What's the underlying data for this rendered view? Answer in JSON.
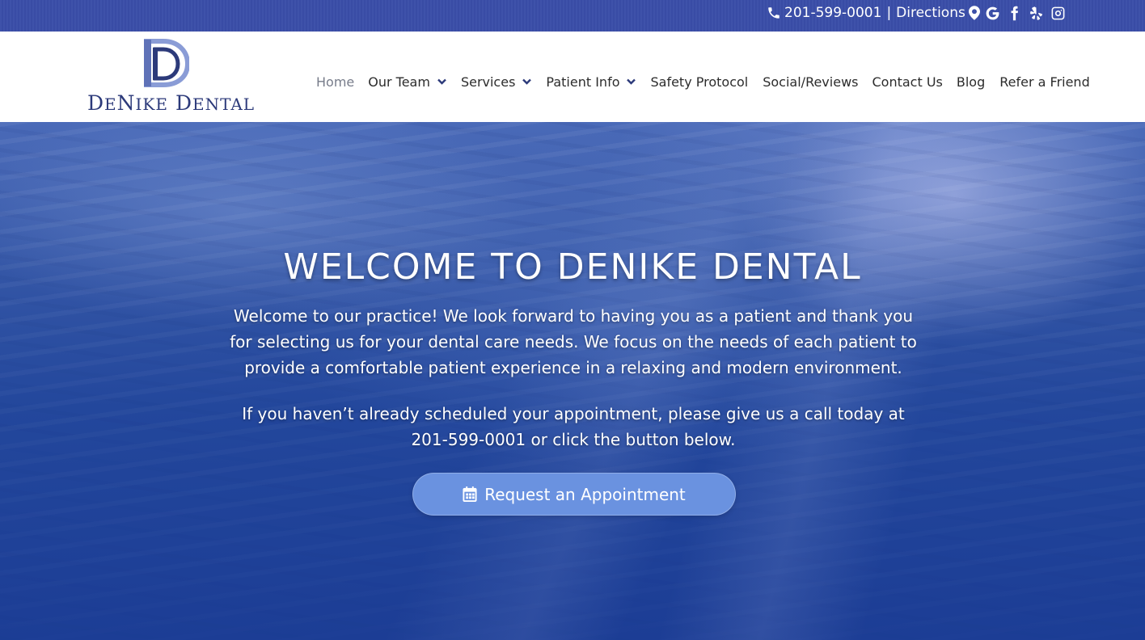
{
  "topbar": {
    "phone": "201-599-0001",
    "separator": "|",
    "directions": "Directions",
    "icons": [
      "phone-icon",
      "map-pin-icon",
      "google-icon",
      "facebook-icon",
      "yelp-icon",
      "instagram-icon"
    ]
  },
  "logo": {
    "text_de": "D",
    "text_e": "E",
    "text_n": "N",
    "text_ike": "IKE",
    "text_d2": "D",
    "text_ental": "ENTAL"
  },
  "nav": {
    "items": [
      {
        "label": "Home",
        "active": true
      },
      {
        "label": "Our Team",
        "dropdown": true
      },
      {
        "label": "Services",
        "dropdown": true
      },
      {
        "label": "Patient Info",
        "dropdown": true
      },
      {
        "label": "Safety Protocol"
      },
      {
        "label": "Social/Reviews"
      },
      {
        "label": "Contact Us"
      },
      {
        "label": "Blog"
      },
      {
        "label": "Refer a Friend"
      }
    ]
  },
  "hero": {
    "title": "WELCOME TO DENIKE DENTAL",
    "paragraph1": "Welcome to our practice! We look forward to having you as a patient and thank you for selecting us for your dental care needs. We focus on the needs of each patient to provide a comfortable patient experience in a relaxing and modern environment.",
    "paragraph2": "If you haven’t already scheduled your appointment, please give us a call today at 201-599-0001 or click the button below.",
    "cta_label": "Request an Appointment",
    "cta_icon": "calendar-icon"
  },
  "colors": {
    "topbar_bg": "#3a4ea8",
    "brand_navy": "#2c3a7a",
    "cta_bg": "#6a92e0",
    "nav_active": "#777c8a"
  }
}
